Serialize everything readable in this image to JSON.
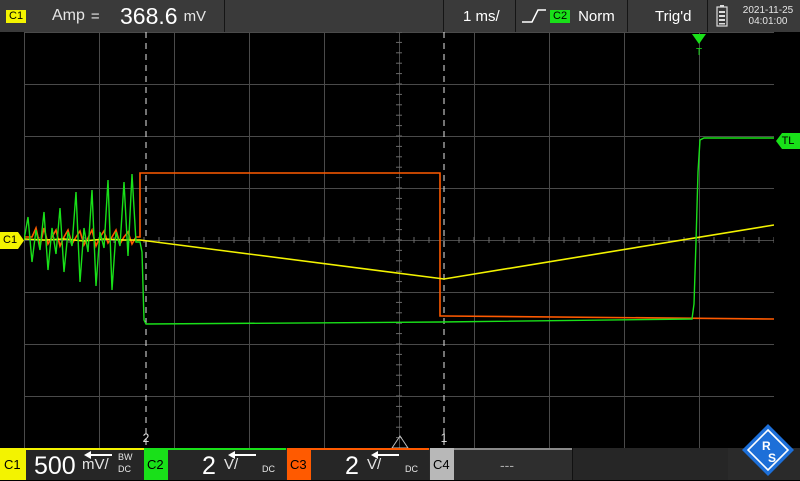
{
  "header": {
    "channel_badge": "C1",
    "measurement_label": "Amp",
    "measurement_value": "368.6",
    "measurement_unit": "mV",
    "timebase": "1 ms/",
    "trigger_source": "C2",
    "trigger_mode": "Norm",
    "trigger_state": "Trig'd",
    "date": "2021-11-25",
    "time": "04:01:00",
    "icons": [
      "rising-edge-icon",
      "battery-icon"
    ]
  },
  "markers": {
    "cursor_a": "2",
    "cursor_b": "1",
    "trigger_top": "T",
    "trigger_level": "TL",
    "channel_ref": "C1"
  },
  "channels": [
    {
      "badge": "C1",
      "scale": "500",
      "unit": "mV/",
      "bw": "BW",
      "coupling": "DC",
      "color": "#f3f300"
    },
    {
      "badge": "C2",
      "scale": "2",
      "unit": "V/",
      "coupling": "DC",
      "color": "#19e019"
    },
    {
      "badge": "C3",
      "scale": "2",
      "unit": "V/",
      "coupling": "DC",
      "color": "#ff5a00"
    },
    {
      "badge": "C4",
      "value": "---",
      "color": "#b8b8b8"
    }
  ],
  "brand_icon": "rohde-schwarz-logo-icon",
  "colors": {
    "ch1": "#f3f300",
    "ch2": "#19e019",
    "ch3": "#ff5a00",
    "grid": "#4a4a4a",
    "background": "#000000"
  }
}
